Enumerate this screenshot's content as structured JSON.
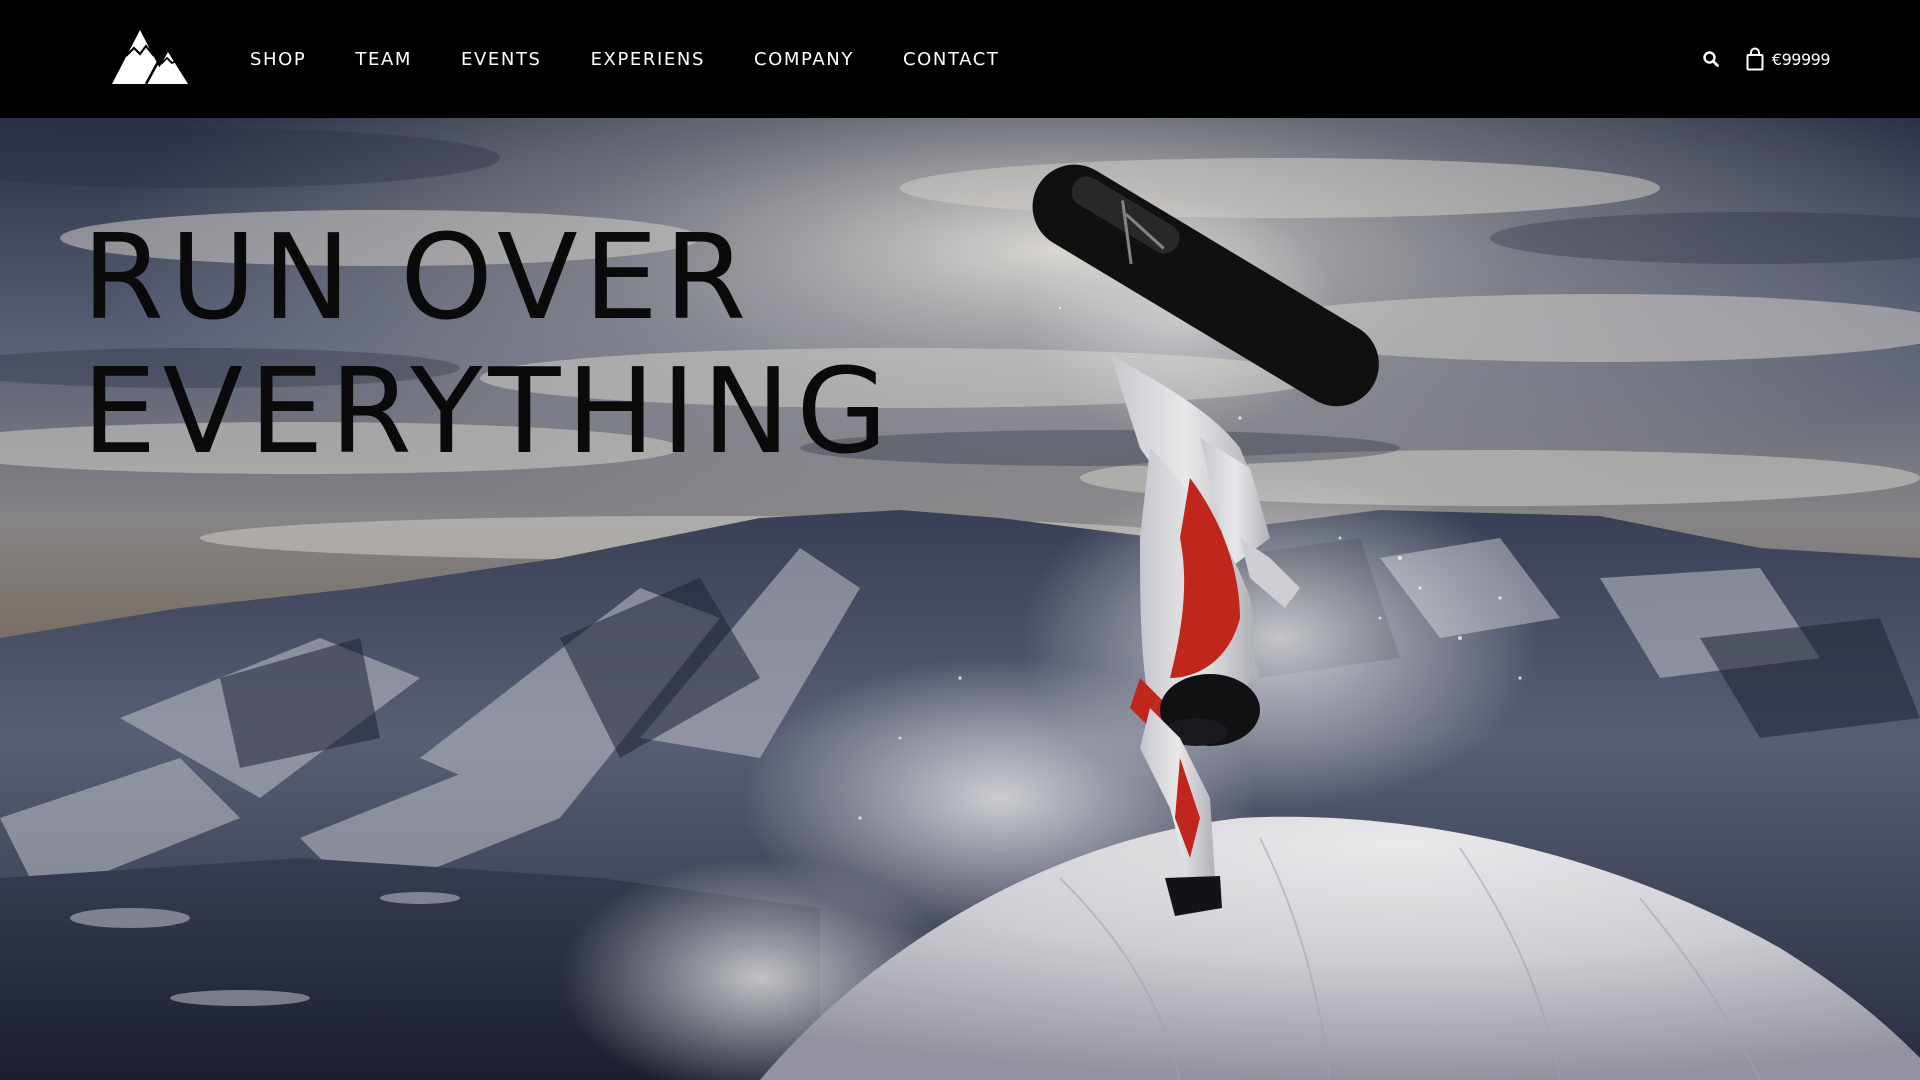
{
  "header": {
    "logo_icon": "mountain-logo-icon",
    "nav": [
      {
        "label": "SHOP"
      },
      {
        "label": "TEAM"
      },
      {
        "label": "EVENTS"
      },
      {
        "label": "EXPERIENS"
      },
      {
        "label": "COMPANY"
      },
      {
        "label": "CONTACT"
      }
    ],
    "search_icon": "search-icon",
    "cart_icon": "shopping-bag-icon",
    "cart_total": "€99999"
  },
  "hero": {
    "headline_line1": "RUN OVER",
    "headline_line2": "EVERYTHING",
    "image": "snowboarder-handplant-on-snow-peak-photo"
  },
  "colors": {
    "header_bg": "#000000",
    "nav_text": "#ffffff",
    "headline_text": "#0a0a0a",
    "jacket_red": "#c8281e"
  }
}
